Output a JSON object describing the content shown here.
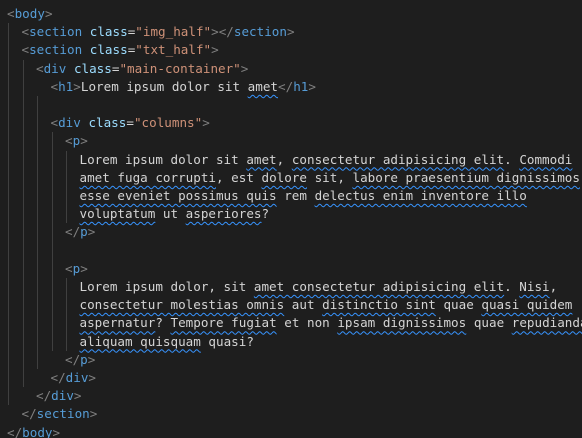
{
  "editor": {
    "colors": {
      "background": "#1e1e1e",
      "tag": "#569cd6",
      "bracket": "#808080",
      "attribute": "#9cdcfe",
      "string": "#ce9178",
      "text": "#d4d4d4",
      "spell_squiggle": "#3794ff"
    },
    "lines": [
      {
        "indent": 0,
        "tokens": [
          [
            "br",
            "<"
          ],
          [
            "tag",
            "body"
          ],
          [
            "br",
            ">"
          ]
        ]
      },
      {
        "indent": 1,
        "tokens": [
          [
            "br",
            "<"
          ],
          [
            "tag",
            "section"
          ],
          [
            "txt",
            " "
          ],
          [
            "attr",
            "class"
          ],
          [
            "txt",
            "="
          ],
          [
            "str",
            "\"img_half\""
          ],
          [
            "br",
            "></"
          ],
          [
            "tag",
            "section"
          ],
          [
            "br",
            ">"
          ]
        ]
      },
      {
        "indent": 1,
        "tokens": [
          [
            "br",
            "<"
          ],
          [
            "tag",
            "section"
          ],
          [
            "txt",
            " "
          ],
          [
            "attr",
            "class"
          ],
          [
            "txt",
            "="
          ],
          [
            "str",
            "\"txt_half\""
          ],
          [
            "br",
            ">"
          ]
        ]
      },
      {
        "indent": 2,
        "tokens": [
          [
            "br",
            "<"
          ],
          [
            "tag",
            "div"
          ],
          [
            "txt",
            " "
          ],
          [
            "attr",
            "class"
          ],
          [
            "txt",
            "="
          ],
          [
            "str",
            "\"main-container\""
          ],
          [
            "br",
            ">"
          ]
        ]
      },
      {
        "indent": 3,
        "tokens": [
          [
            "br",
            "<"
          ],
          [
            "tag",
            "h1"
          ],
          [
            "br",
            ">"
          ],
          [
            "txt",
            "Lorem ipsum dolor sit "
          ],
          [
            "sq",
            "amet"
          ],
          [
            "br",
            "</"
          ],
          [
            "tag",
            "h1"
          ],
          [
            "br",
            ">"
          ]
        ]
      },
      {
        "indent": 0,
        "tokens": []
      },
      {
        "indent": 3,
        "tokens": [
          [
            "br",
            "<"
          ],
          [
            "tag",
            "div"
          ],
          [
            "txt",
            " "
          ],
          [
            "attr",
            "class"
          ],
          [
            "txt",
            "="
          ],
          [
            "str",
            "\"columns\""
          ],
          [
            "br",
            ">"
          ]
        ]
      },
      {
        "indent": 4,
        "tokens": [
          [
            "br",
            "<"
          ],
          [
            "tag",
            "p"
          ],
          [
            "br",
            ">"
          ]
        ]
      },
      {
        "indent": 5,
        "tokens": [
          [
            "txt",
            "Lorem ipsum dolor sit "
          ],
          [
            "sq",
            "amet"
          ],
          [
            "txt",
            ", "
          ],
          [
            "sq",
            "consectetur adipisicing elit"
          ],
          [
            "txt",
            ". "
          ],
          [
            "sq",
            "Commodi"
          ]
        ]
      },
      {
        "indent": 5,
        "tokens": [
          [
            "sq",
            "amet fuga corrupti"
          ],
          [
            "txt",
            ", est "
          ],
          [
            "sq",
            "dolore"
          ],
          [
            "txt",
            " sit, "
          ],
          [
            "sq",
            "labore praesentium dignissimos"
          ],
          [
            "txt",
            ","
          ]
        ]
      },
      {
        "indent": 5,
        "tokens": [
          [
            "sq",
            "esse eveniet possimus quis"
          ],
          [
            "txt",
            " rem "
          ],
          [
            "sq",
            "delectus enim inventore illo"
          ]
        ]
      },
      {
        "indent": 5,
        "tokens": [
          [
            "sq",
            "voluptatum"
          ],
          [
            "txt",
            " ut "
          ],
          [
            "sq",
            "asperiores"
          ],
          [
            "txt",
            "?"
          ]
        ]
      },
      {
        "indent": 4,
        "tokens": [
          [
            "br",
            "</"
          ],
          [
            "tag",
            "p"
          ],
          [
            "br",
            ">"
          ]
        ]
      },
      {
        "indent": 0,
        "tokens": []
      },
      {
        "indent": 4,
        "tokens": [
          [
            "br",
            "<"
          ],
          [
            "tag",
            "p"
          ],
          [
            "br",
            ">"
          ]
        ]
      },
      {
        "indent": 5,
        "tokens": [
          [
            "txt",
            "Lorem ipsum dolor, sit "
          ],
          [
            "sq",
            "amet consectetur adipisicing elit"
          ],
          [
            "txt",
            ". "
          ],
          [
            "sq",
            "Nisi"
          ],
          [
            "txt",
            ","
          ]
        ]
      },
      {
        "indent": 5,
        "tokens": [
          [
            "sq",
            "consectetur molestias omnis"
          ],
          [
            "txt",
            " aut "
          ],
          [
            "sq",
            "distinctio sint"
          ],
          [
            "txt",
            " quae "
          ],
          [
            "sq",
            "quasi quidem"
          ]
        ]
      },
      {
        "indent": 5,
        "tokens": [
          [
            "sq",
            "aspernatur"
          ],
          [
            "txt",
            "? "
          ],
          [
            "sq",
            "Tempore fugiat"
          ],
          [
            "txt",
            " et non "
          ],
          [
            "sq",
            "ipsam dignissimos"
          ],
          [
            "txt",
            " quae "
          ],
          [
            "sq",
            "repudiandae"
          ]
        ]
      },
      {
        "indent": 5,
        "tokens": [
          [
            "sq",
            "aliquam quisquam"
          ],
          [
            "txt",
            " quasi?"
          ]
        ]
      },
      {
        "indent": 4,
        "tokens": [
          [
            "br",
            "</"
          ],
          [
            "tag",
            "p"
          ],
          [
            "br",
            ">"
          ]
        ]
      },
      {
        "indent": 3,
        "tokens": [
          [
            "br",
            "</"
          ],
          [
            "tag",
            "div"
          ],
          [
            "br",
            ">"
          ]
        ]
      },
      {
        "indent": 2,
        "tokens": [
          [
            "br",
            "</"
          ],
          [
            "tag",
            "div"
          ],
          [
            "br",
            ">"
          ]
        ]
      },
      {
        "indent": 1,
        "tokens": [
          [
            "br",
            "</"
          ],
          [
            "tag",
            "section"
          ],
          [
            "br",
            ">"
          ]
        ]
      },
      {
        "indent": 0,
        "tokens": [
          [
            "br",
            "</"
          ],
          [
            "tag",
            "body"
          ],
          [
            "br",
            ">"
          ]
        ]
      }
    ]
  }
}
